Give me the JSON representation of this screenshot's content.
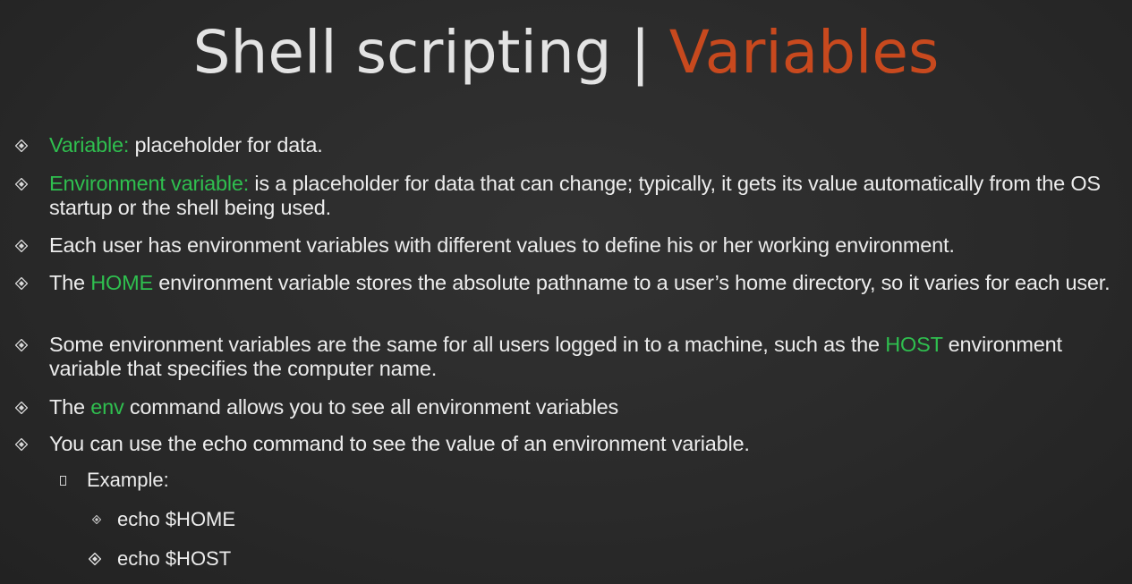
{
  "title": {
    "main": "Shell scripting | ",
    "accent": "Variables"
  },
  "colors": {
    "accent": "#c8491e",
    "highlight": "#2fbf4f",
    "text": "#ececec",
    "background": "#2b2b2b"
  },
  "bullets": [
    {
      "hl": "Variable:",
      "text": " placeholder for data."
    },
    {
      "hl": "Environment variable:",
      "text": " is a placeholder for data that can change; typically, it gets its value automatically from the OS startup or the shell being used."
    },
    {
      "text": "Each user has environment variables with different values to define his or her working environment."
    },
    {
      "pre": "The ",
      "hl": "HOME",
      "text": " environment variable stores the absolute pathname to a user’s home directory, so it varies for each user."
    },
    {
      "pre": "Some environment variables are the same for all users logged in to a machine, such as the ",
      "hl": "HOST",
      "text": " environment variable that specifies the computer name."
    },
    {
      "pre": "The ",
      "hl": "env",
      "text": " command allows you to see all environment variables"
    },
    {
      "text": "You can use the echo command to see the value of an environment variable."
    }
  ],
  "example": {
    "label": "Example:",
    "items": [
      "echo $HOME",
      "echo $HOST"
    ]
  },
  "icons": {
    "bullet": "diamond-bullet-icon",
    "sub_bullet": "square-bullet-icon"
  }
}
